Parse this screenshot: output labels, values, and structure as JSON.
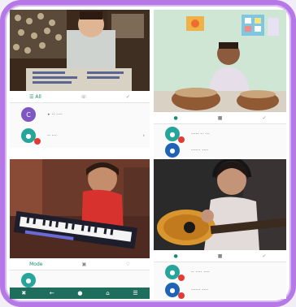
{
  "colors": {
    "frame_border": "#b678e6",
    "accent_green": "#1a8b6f",
    "avatar_purple": "#7e57c2",
    "avatar_teal": "#26a69a",
    "avatar_blue": "#1e63b5",
    "badge_red": "#e53935"
  },
  "panels": [
    {
      "id": "top-left",
      "tabs": [
        {
          "label": "☰ All",
          "icon": "list-icon"
        },
        {
          "label": "☏",
          "icon": "phone-icon"
        },
        {
          "label": "✓",
          "icon": "check-icon"
        }
      ],
      "rows": [
        {
          "avatar_text": "C",
          "text": "• ·· ····",
          "end": ""
        },
        {
          "avatar_text": "●",
          "text": "·· ···",
          "end": "›"
        }
      ]
    },
    {
      "id": "top-right",
      "tabs": [
        {
          "label": "●",
          "icon": "record-icon"
        },
        {
          "label": "■",
          "icon": "stop-icon"
        },
        {
          "label": "✓",
          "icon": "check-icon"
        }
      ],
      "rows": [
        {
          "avatar_text": "●",
          "text": "····· ·· ···",
          "end": ""
        },
        {
          "avatar_text": "●",
          "text": "······ ····",
          "end": ""
        }
      ]
    },
    {
      "id": "bottom-left",
      "tabs": [
        {
          "label": "Mode",
          "icon": "mode-icon"
        },
        {
          "label": "▣",
          "icon": "screen-icon"
        },
        {
          "label": "♡",
          "icon": "heart-icon"
        }
      ],
      "rows": [
        {
          "avatar_text": "●",
          "text": "",
          "end": ""
        }
      ]
    },
    {
      "id": "bottom-right",
      "tabs": [
        {
          "label": "●",
          "icon": "record-icon"
        },
        {
          "label": "■",
          "icon": "stop-icon"
        },
        {
          "label": "✓",
          "icon": "check-icon"
        }
      ],
      "rows": [
        {
          "avatar_text": "●",
          "text": "·· ···· ····",
          "end": ""
        },
        {
          "avatar_text": "●",
          "text": "······ ····",
          "end": ""
        }
      ]
    }
  ],
  "bottom_nav": [
    "✖",
    "←",
    "●",
    "⌂",
    "☰"
  ]
}
